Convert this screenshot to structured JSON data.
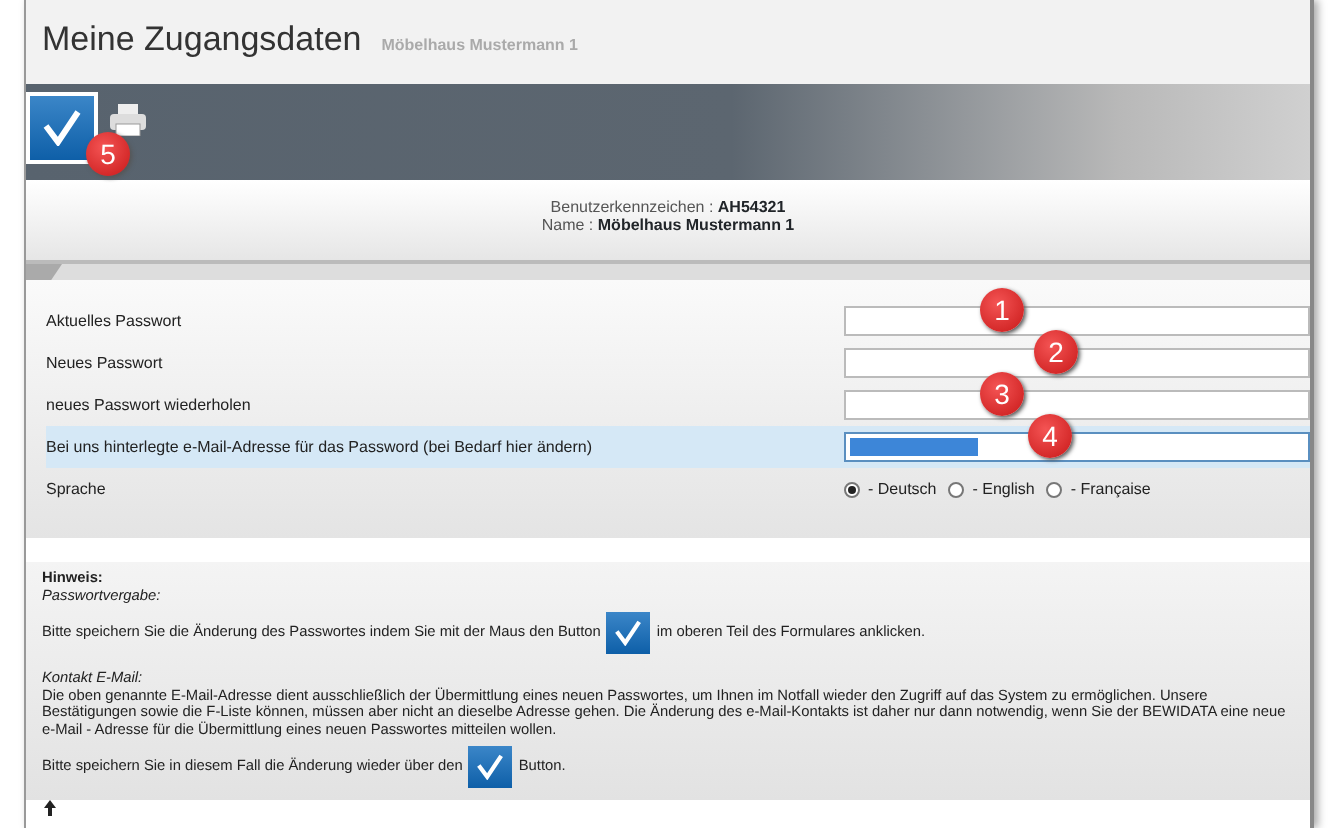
{
  "title": "Meine Zugangsdaten",
  "subtitle": "Möbelhaus Mustermann 1",
  "toolbar": {
    "save_callout": "5"
  },
  "account": [
    {
      "label": "Benutzerkennzeichen :",
      "value": "AH54321"
    },
    {
      "label": "Name :",
      "value": "Möbelhaus Mustermann 1"
    }
  ],
  "fields": [
    {
      "label": "Aktuelles Passwort",
      "callout": "1",
      "focused": false
    },
    {
      "label": "Neues Passwort",
      "callout": "2",
      "focused": false
    },
    {
      "label": "neues Passwort wiederholen",
      "callout": "3",
      "focused": false
    },
    {
      "label": "Bei uns hinterlegte e-Mail-Adresse für das Password (bei Bedarf hier ändern)",
      "callout": "4",
      "focused": true
    }
  ],
  "language": {
    "label": "Sprache",
    "options": [
      {
        "label": "- Deutsch",
        "selected": true
      },
      {
        "label": "- English",
        "selected": false
      },
      {
        "label": "- Française",
        "selected": false
      }
    ]
  },
  "hint": {
    "heading": "Hinweis:",
    "sections": [
      {
        "title": "Passwortvergabe:",
        "before": "Bitte speichern Sie die Änderung des Passwortes indem Sie mit der Maus den Button",
        "after": "im oberen Teil des Formulares anklicken."
      },
      {
        "title": "Kontakt E-Mail:",
        "text": "Die oben genannte E-Mail-Adresse dient ausschließlich der Übermittlung eines neuen Passwortes, um Ihnen im Notfall wieder den Zugriff auf das System zu ermöglichen. Unsere Bestätigungen sowie die F-Liste können, müssen aber nicht an dieselbe Adresse gehen. Die Änderung des e-Mail-Kontakts ist daher nur dann notwendig, wenn Sie der BEWIDATA eine neue e-Mail - Adresse für die Übermittlung eines neuen Passwortes mitteilen wollen.",
        "before": "Bitte speichern Sie in diesem Fall die Änderung wieder über den",
        "after": "Button."
      }
    ]
  }
}
